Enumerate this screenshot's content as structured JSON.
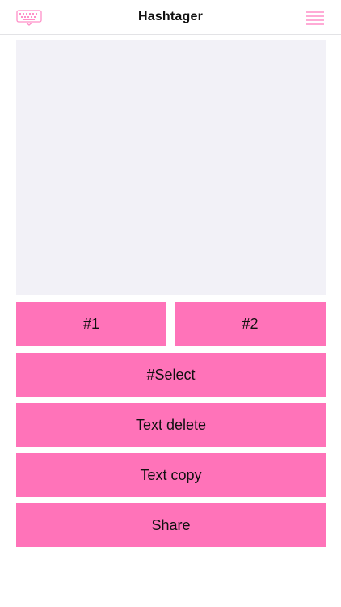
{
  "header": {
    "title": "Hashtager",
    "left_icon": "keyboard-icon",
    "right_icon": "menu-icon"
  },
  "editor": {
    "value": "",
    "placeholder": ""
  },
  "buttons": {
    "hashtag_1": "#1",
    "hashtag_2": "#2",
    "select": "#Select",
    "text_delete": "Text delete",
    "text_copy": "Text copy",
    "share": "Share"
  },
  "colors": {
    "accent": "#ff73b9",
    "icon_pink": "#ff8fc8",
    "text_area_bg": "#f2f1f7"
  }
}
